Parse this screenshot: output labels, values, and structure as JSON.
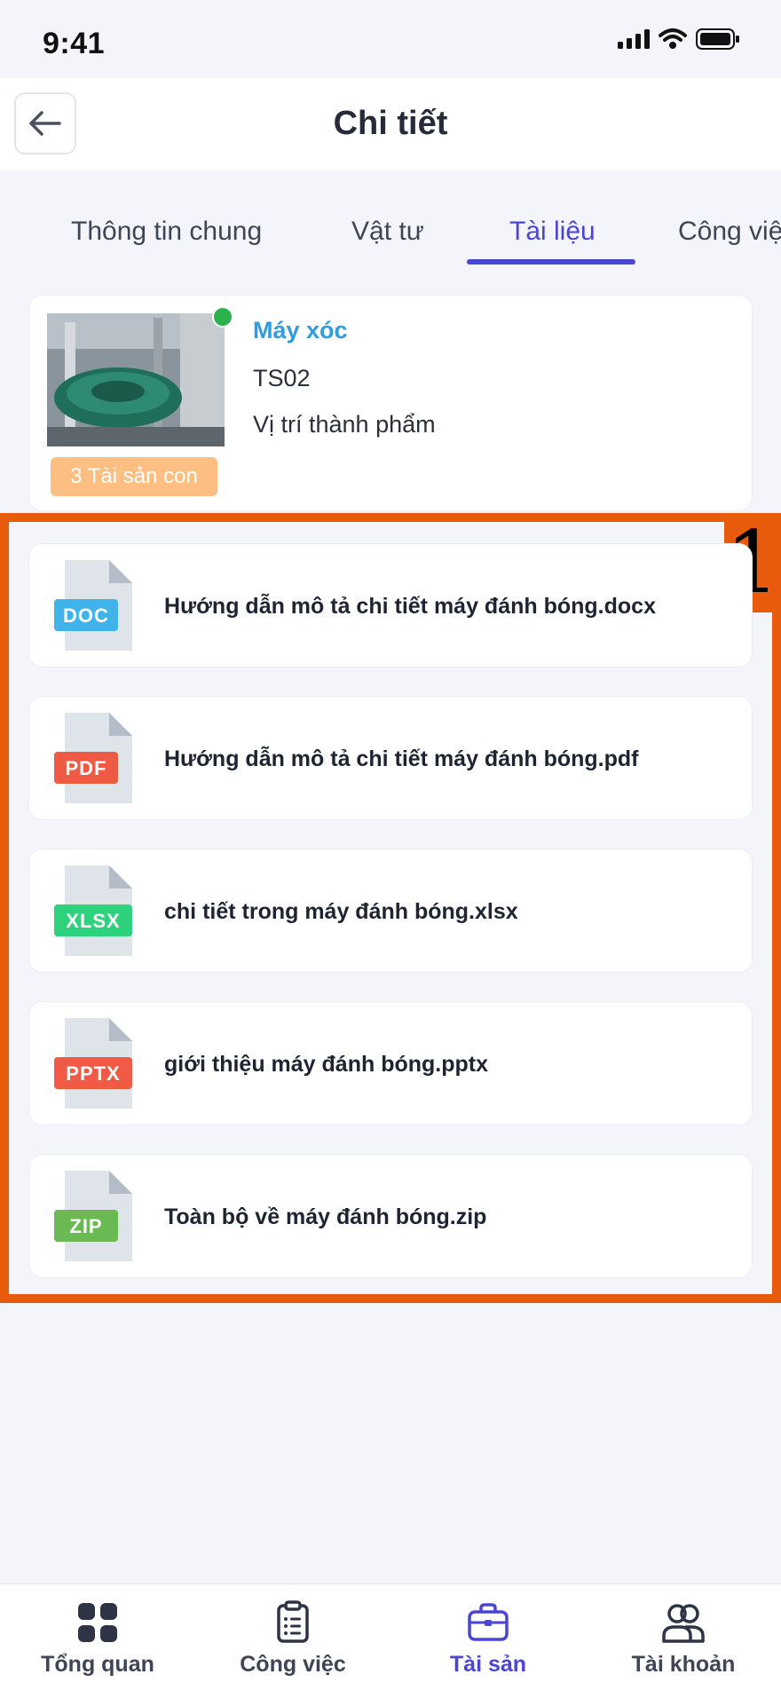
{
  "status_bar": {
    "time": "9:41"
  },
  "header": {
    "title": "Chi tiết",
    "back_icon": "arrow-left-icon"
  },
  "tabs": [
    {
      "label": "Thông tin chung",
      "active": false
    },
    {
      "label": "Vật tư",
      "active": false
    },
    {
      "label": "Tài liệu",
      "active": true
    },
    {
      "label": "Công việc",
      "active": false
    }
  ],
  "asset": {
    "name": "Máy xóc",
    "code": "TS02",
    "location": "Vị trí thành phẩm",
    "child_badge": "3 Tài sản con",
    "status": "online",
    "status_color": "#2bb24c"
  },
  "highlight": {
    "label": "1",
    "color": "#e85a0c"
  },
  "files": [
    {
      "name": "Hướng dẫn mô tả chi tiết máy đánh bóng.docx",
      "type": "DOC",
      "badge_color": "#3fb3ea"
    },
    {
      "name": "Hướng dẫn mô tả chi tiết máy đánh bóng.pdf",
      "type": "PDF",
      "badge_color": "#ee5a44"
    },
    {
      "name": "chi tiết trong máy đánh bóng.xlsx",
      "type": "XLSX",
      "badge_color": "#2fd27c"
    },
    {
      "name": "giới thiệu máy đánh bóng.pptx",
      "type": "PPTX",
      "badge_color": "#f15a45"
    },
    {
      "name": "Toàn bộ về máy đánh bóng.zip",
      "type": "ZIP",
      "badge_color": "#6ab952"
    }
  ],
  "bottom_nav": [
    {
      "label": "Tổng quan",
      "icon": "grid-icon",
      "active": false
    },
    {
      "label": "Công việc",
      "icon": "clipboard-list-icon",
      "active": false
    },
    {
      "label": "Tài sản",
      "icon": "briefcase-icon",
      "active": true
    },
    {
      "label": "Tài khoản",
      "icon": "users-icon",
      "active": false
    }
  ],
  "colors": {
    "accent": "#4b45d6",
    "asset_name": "#2f9be0",
    "badge": "#ffbf82"
  }
}
